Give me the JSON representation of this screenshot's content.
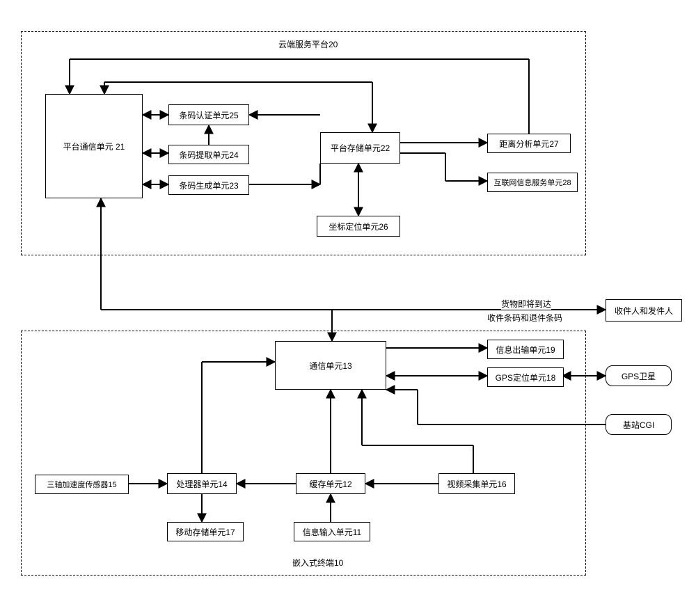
{
  "cloud": {
    "title": "云端服务平台20",
    "units": {
      "comm": "平台通信单元  21",
      "auth": "条码认证单元25",
      "extract": "条码提取单元24",
      "gen": "条码生成单元23",
      "store": "平台存储单元22",
      "coord": "坐标定位单元26",
      "distance": "距离分析单元27",
      "internet": "互联网信息服务单元28"
    }
  },
  "terminal": {
    "title": "嵌入式终端10",
    "units": {
      "comm": "通信单元13",
      "output": "信息出输单元19",
      "gps": "GPS定位单元18",
      "accel": "三轴加速度传感器15",
      "processor": "处理器单元14",
      "cache": "缓存单元12",
      "mobilestore": "移动存储单元17",
      "input": "信息输入单元11",
      "video": "视频采集单元16"
    }
  },
  "external": {
    "recipients": "收件人和发件人",
    "gps_sat": "GPS卫星",
    "base_cgi": "基站CGI"
  },
  "annotations": {
    "arrive": "货物即将到达",
    "barcode": "收件条码和退件条码"
  }
}
